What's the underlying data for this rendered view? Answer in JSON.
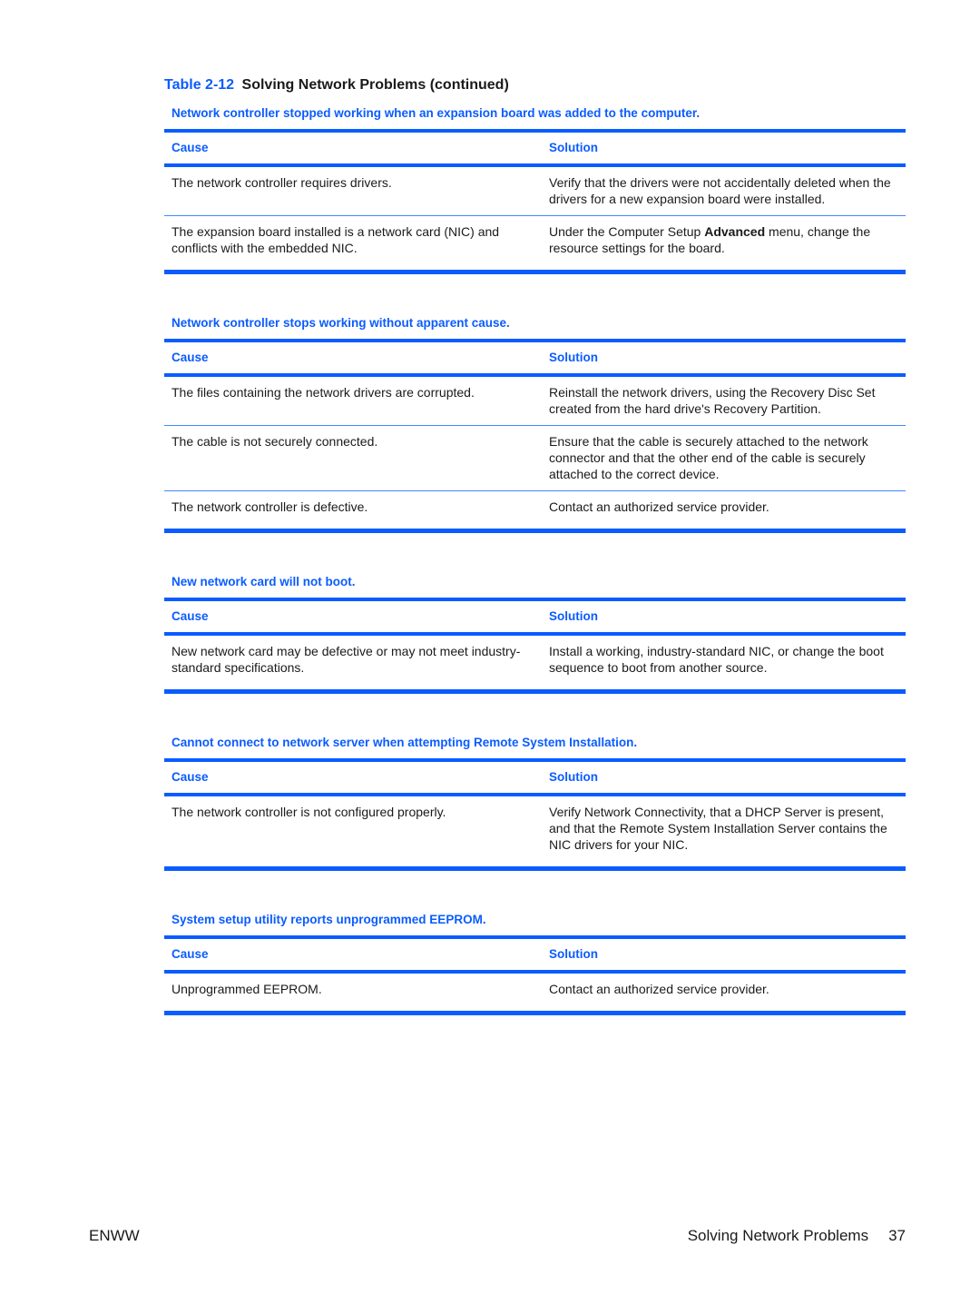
{
  "caption": {
    "number": "Table 2-12",
    "title": "Solving Network Problems (continued)"
  },
  "colors": {
    "accent": "#0a5cff",
    "row_rule": "#3d8bff",
    "text": "#1a1a1a"
  },
  "headers": {
    "cause": "Cause",
    "solution": "Solution"
  },
  "sections": [
    {
      "title": "Network controller stopped working when an expansion board was added to the computer.",
      "rows": [
        {
          "cause": "The network controller requires drivers.",
          "solution": "Verify that the drivers were not accidentally deleted when the drivers for a new expansion board were installed."
        },
        {
          "cause": "The expansion board installed is a network card (NIC) and conflicts with the embedded NIC.",
          "solution_pre": "Under the Computer Setup ",
          "solution_bold": "Advanced",
          "solution_post": " menu, change the resource settings for the board."
        }
      ]
    },
    {
      "title": "Network controller stops working without apparent cause.",
      "rows": [
        {
          "cause": "The files containing the network drivers are corrupted.",
          "solution": "Reinstall the network drivers, using the Recovery Disc Set created from the hard drive's Recovery Partition."
        },
        {
          "cause": "The cable is not securely connected.",
          "solution": "Ensure that the cable is securely attached to the network connector and that the other end of the cable is securely attached to the correct device."
        },
        {
          "cause": "The network controller is defective.",
          "solution": "Contact an authorized service provider."
        }
      ]
    },
    {
      "title": "New network card will not boot.",
      "rows": [
        {
          "cause": "New network card may be defective or may not meet industry-standard specifications.",
          "solution": "Install a working, industry-standard NIC, or change the boot sequence to boot from another source."
        }
      ]
    },
    {
      "title": "Cannot connect to network server when attempting Remote System Installation.",
      "rows": [
        {
          "cause": "The network controller is not configured properly.",
          "solution": "Verify Network Connectivity, that a DHCP Server is present, and that the Remote System Installation Server contains the NIC drivers for your NIC."
        }
      ]
    },
    {
      "title": "System setup utility reports unprogrammed EEPROM.",
      "rows": [
        {
          "cause": "Unprogrammed EEPROM.",
          "solution": "Contact an authorized service provider."
        }
      ]
    }
  ],
  "footer": {
    "left": "ENWW",
    "section": "Solving Network Problems",
    "page": "37"
  }
}
